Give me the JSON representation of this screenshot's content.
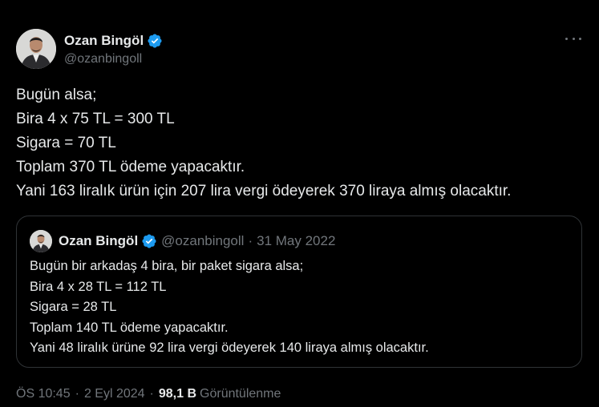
{
  "author": {
    "display_name": "Ozan Bingöl",
    "handle": "@ozanbingoll",
    "verified": true
  },
  "colors": {
    "background": "#000000",
    "text": "#e7e9ea",
    "secondary_text": "#71767b",
    "verified_badge": "#1d9bf0",
    "border": "#2f3336"
  },
  "tweet": {
    "lines": [
      "Bugün alsa;",
      "Bira 4 x 75 TL = 300 TL",
      "Sigara = 70 TL",
      "Toplam 370 TL ödeme yapacaktır.",
      "Yani 163 liralık ürün için 207 lira vergi ödeyerek 370 liraya almış olacaktır."
    ]
  },
  "quoted_tweet": {
    "display_name": "Ozan Bingöl",
    "handle": "@ozanbingoll",
    "separator": "·",
    "date": "31 May 2022",
    "lines": [
      "Bugün bir arkadaş 4 bira, bir paket sigara alsa;",
      "Bira 4 x 28 TL = 112 TL",
      "Sigara = 28 TL",
      "Toplam 140 TL ödeme yapacaktır.",
      "Yani 48 liralık ürüne 92 lira vergi ödeyerek 140 liraya almış olacaktır."
    ]
  },
  "meta": {
    "time": "ÖS 10:45",
    "separator": "·",
    "date": "2 Eyl 2024",
    "views_count": "98,1 B",
    "views_label": "Görüntülenme"
  },
  "icons": {
    "more": "more-icon",
    "verified": "verified-badge-icon"
  }
}
